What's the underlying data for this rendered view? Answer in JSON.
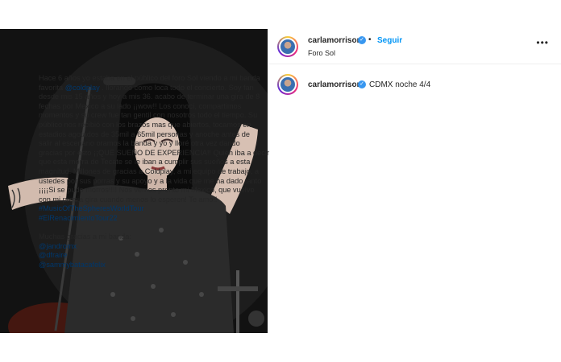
{
  "header": {
    "username": "carlamorrison",
    "separator": "•",
    "follow_label": "Seguir",
    "location": "Foro Sol",
    "more_label": "•••"
  },
  "caption": {
    "username": "carlamorrison",
    "title": "CDMX noche 4/4",
    "paragraph_1": [
      "Hace 6 años yo estaba en el público del foro Sol viendo a mi banda",
      "favorita ",
      "@coldplay",
      " . llorando como loca todo el concierto. Soy fan",
      "desde mis 15 años y hoy a mis 36. acabo de terminar una gira de 8",
      "fechas por Mexico a su lado ¡¡wow!! Los conocí, compartimos",
      "momentos y su crew fue tan gentil con nosotros todo el tiempo. Su",
      "público nos recibió con los brazos mas que abiertos, tocamos en",
      "estadios agotados de 35mil a 65mil personas y anoche antes de",
      "salir al escenario oramos la banda y yo y lloré otra vez dando",
      "gracias por esto ¡¡QUE SUEÑO DE EXPERIENCIA!! Quién iba a decir",
      "que esta morra de Tecate se le iban a cumplir sus sueños a esta",
      "magnitud. Millones de gracias a Coldplay, a mi equipo de trabajo, a",
      "ustedes por sus porras y su apoyo y a la vida que me ha dado tanto",
      "¡¡¡¡Si se pudo morros!!!! Nos vemos pronto mi Mexico, que vuelvo",
      "con mi propia gira cuando menos lo esperen! Te amo!!"
    ],
    "hashtags": [
      "#MusicOfTheSpheresWorldTour",
      "#ElRenacimientoTour22"
    ],
    "thanks_line": "Muchas gracias a mi banda:",
    "band_mentions": [
      "@jandromx",
      "@dfraire",
      "@sammybatacafelix"
    ]
  },
  "colors": {
    "link": "#00376b",
    "follow": "#0095f6",
    "verified": "#3897f0"
  }
}
